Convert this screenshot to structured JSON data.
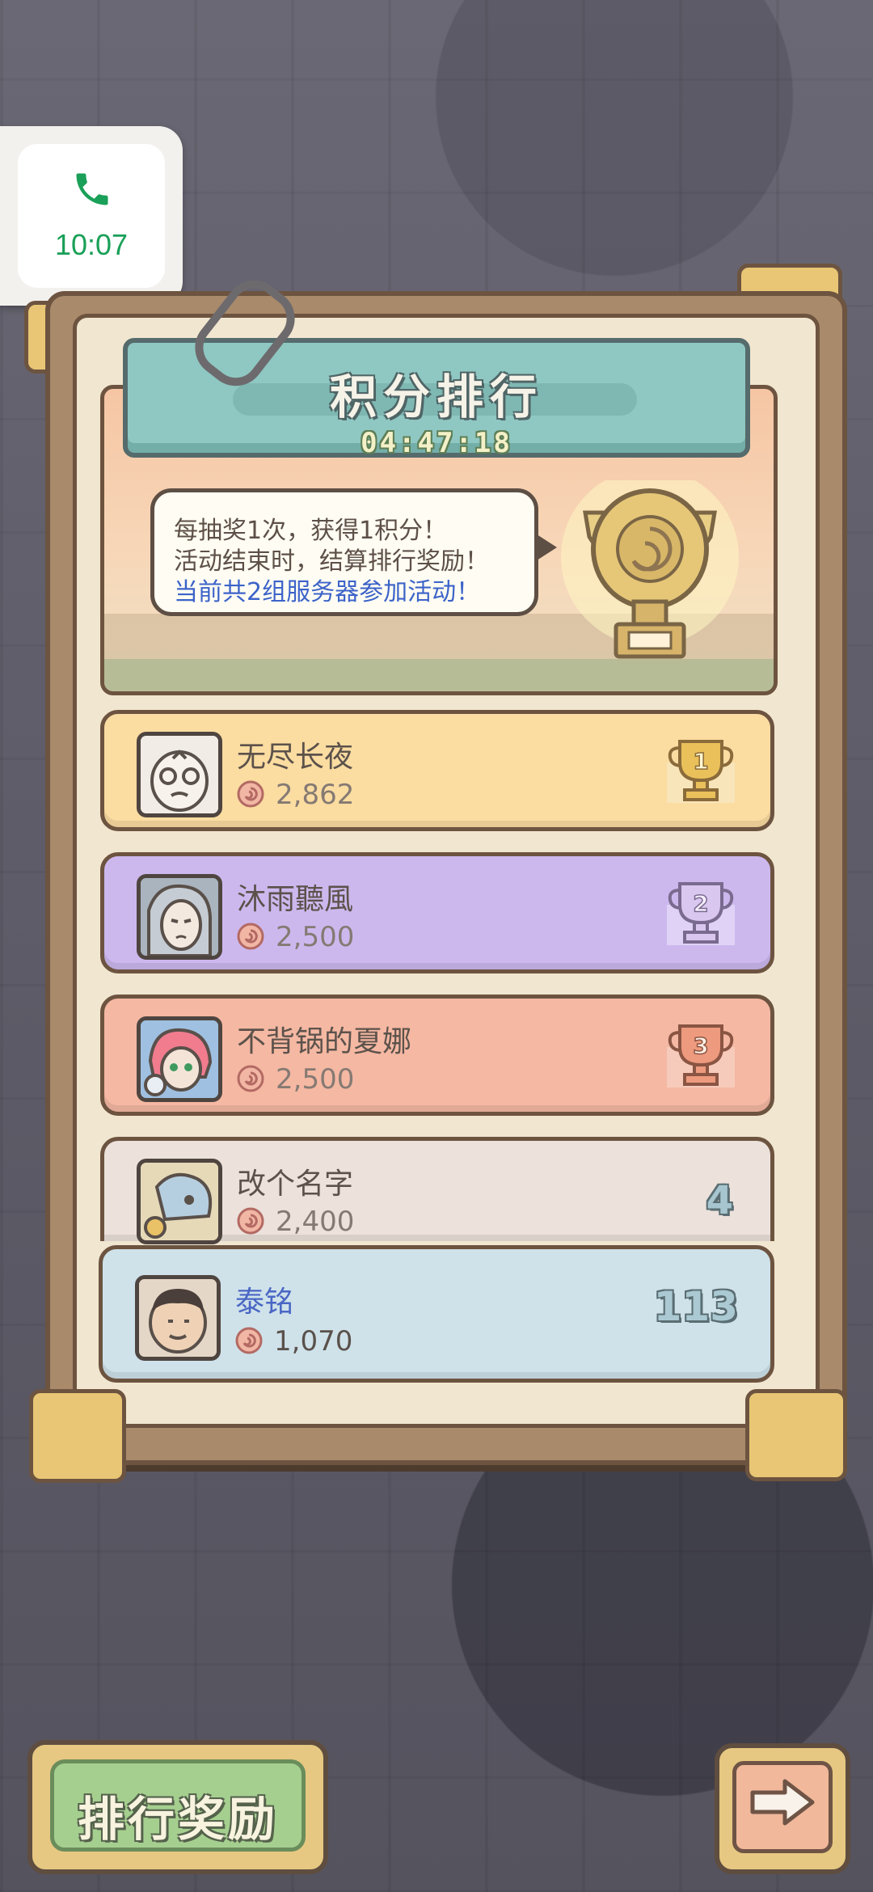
{
  "status_chip": {
    "call_time": "10:07",
    "icon": "phone-icon",
    "accent_color": "#1aa058"
  },
  "event": {
    "title": "积分排行",
    "countdown": "04:47:18",
    "info_lines": [
      "每抽奖1次，获得1积分！",
      "活动结束时，结算排行奖励！",
      "当前共2组服务器参加活动！"
    ]
  },
  "leaderboard": [
    {
      "rank": "1",
      "name": "无尽长夜",
      "score": "2,862",
      "row_color": "#fbdca1",
      "medal": "gold-trophy-icon"
    },
    {
      "rank": "2",
      "name": "沐雨聽風",
      "score": "2,500",
      "row_color": "#cdb8ee",
      "medal": "silver-trophy-icon"
    },
    {
      "rank": "3",
      "name": "不背锅的夏娜",
      "score": "2,500",
      "row_color": "#f5b8a3",
      "medal": "bronze-trophy-icon"
    },
    {
      "rank": "4",
      "name": "改个名字",
      "score": "2,400",
      "row_color": "#ece1db"
    }
  ],
  "my_rank": {
    "rank": "113",
    "name": "泰铭",
    "score": "1,070",
    "row_color": "#cfe2ea",
    "name_color": "#4a67c4"
  },
  "buttons": {
    "reward_label": "排行奖励",
    "next_icon": "arrow-right-icon"
  }
}
